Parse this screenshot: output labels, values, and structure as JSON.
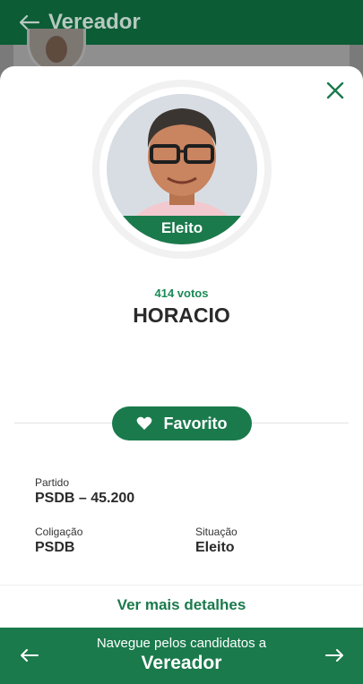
{
  "appbar": {
    "title": "Vereador",
    "back_icon": "arrow-left-icon"
  },
  "candidate": {
    "status_badge": "Eleito",
    "votes": "414 votos",
    "name": "HORACIO"
  },
  "actions": {
    "favorite_label": "Favorito",
    "more_details": "Ver mais detalhes"
  },
  "details": {
    "party_label": "Partido",
    "party_value": "PSDB – 45.200",
    "coalition_label": "Coligação",
    "coalition_value": "PSDB",
    "situation_label": "Situação",
    "situation_value": "Eleito"
  },
  "bottom_nav": {
    "prompt": "Navegue pelos candidatos a",
    "role": "Vereador"
  },
  "colors": {
    "primary": "#1a7a4c",
    "appbar": "#0c5c36",
    "accent_text": "#1a8a57"
  }
}
